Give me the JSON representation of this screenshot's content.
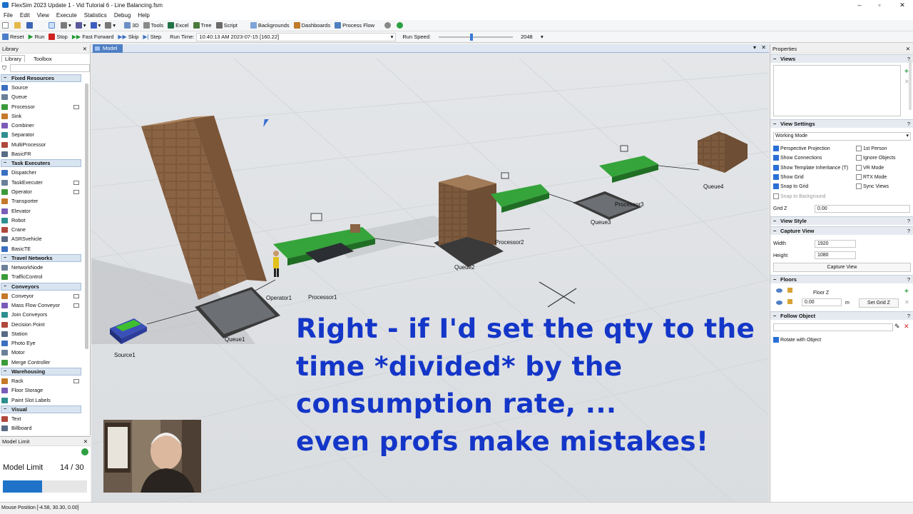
{
  "window": {
    "title": "FlexSim 2023 Update 1 - Vid Tutorial 6 - Line Balancing.fsm"
  },
  "menu": [
    "File",
    "Edit",
    "View",
    "Execute",
    "Statistics",
    "Debug",
    "Help"
  ],
  "toolbar": {
    "view3d": "3D",
    "tools": "Tools",
    "excel": "Excel",
    "tree": "Tree",
    "script": "Script",
    "backgrounds": "Backgrounds",
    "dashboards": "Dashboards",
    "process_flow": "Process Flow"
  },
  "runbar": {
    "reset": "Reset",
    "run": "Run",
    "stop": "Stop",
    "fast_forward": "Fast Forward",
    "skip": "Skip",
    "step": "Step",
    "run_time_label": "Run Time:",
    "run_time_value": "10:40:13 AM  2023-07-15  [160.22]",
    "run_speed_label": "Run Speed:",
    "run_speed_value": "2048",
    "run_speed_fraction": 0.42
  },
  "library": {
    "header": "Library",
    "tabs": [
      "Library",
      "Toolbox"
    ],
    "categories": [
      {
        "name": "Fixed Resources",
        "items": [
          "Source",
          "Queue",
          "Processor",
          "Sink",
          "Combiner",
          "Separator",
          "MultiProcessor",
          "BasicFR"
        ]
      },
      {
        "name": "Task Executers",
        "items": [
          "Dispatcher",
          "TaskExecuter",
          "Operator",
          "Transporter",
          "Elevator",
          "Robot",
          "Crane",
          "ASRSvehicle",
          "BasicTE"
        ]
      },
      {
        "name": "Travel Networks",
        "items": [
          "NetworkNode",
          "TrafficControl"
        ]
      },
      {
        "name": "Conveyors",
        "items": [
          "Conveyor",
          "Mass Flow Conveyor",
          "Join Conveyors",
          "Decision Point",
          "Station",
          "Photo Eye",
          "Motor",
          "Merge Controller"
        ]
      },
      {
        "name": "Warehousing",
        "items": [
          "Rack",
          "Floor Storage",
          "Paint Slot Labels"
        ]
      },
      {
        "name": "Visual",
        "items": [
          "Text",
          "Billboard"
        ]
      }
    ]
  },
  "model_limit": {
    "header": "Model Limit",
    "label": "Model Limit",
    "value": "14 / 30",
    "fill_fraction": 0.47
  },
  "viewport": {
    "tab": "Model",
    "objects": [
      "Source1",
      "Queue1",
      "Operator1",
      "Processor1",
      "Queue2",
      "Processor2",
      "Queue3",
      "Processor3",
      "Queue4"
    ]
  },
  "caption": [
    "Right - if I'd set the qty to the",
    "time *divided* by the",
    "consumption rate, ...",
    "even profs make mistakes!"
  ],
  "properties": {
    "header": "Properties",
    "views": {
      "title": "Views"
    },
    "view_settings": {
      "title": "View Settings",
      "mode": "Working Mode",
      "left_checks": [
        {
          "label": "Perspective Projection",
          "on": true
        },
        {
          "label": "Show Connections",
          "on": true
        },
        {
          "label": "Show Template Inheritance (T)",
          "on": true
        },
        {
          "label": "Show Grid",
          "on": true
        },
        {
          "label": "Snap to Grid",
          "on": true
        },
        {
          "label": "Snap to Background",
          "on": false
        }
      ],
      "right_checks": [
        {
          "label": "1st Person",
          "on": false
        },
        {
          "label": "Ignore Objects",
          "on": false
        },
        {
          "label": "VR Mode",
          "on": false
        },
        {
          "label": "RTX Mode",
          "on": false
        },
        {
          "label": "Sync Views",
          "on": false
        }
      ],
      "grid_z_label": "Grid Z",
      "grid_z_value": "0.00"
    },
    "view_style": {
      "title": "View Style"
    },
    "capture_view": {
      "title": "Capture View",
      "width_label": "Width",
      "width_value": "1920",
      "height_label": "Height",
      "height_value": "1080",
      "button": "Capture View"
    },
    "floors": {
      "title": "Floors",
      "floor_name": "Floor Z",
      "floor_value": "0.00",
      "unit": "m",
      "button": "Set Grid Z"
    },
    "follow_object": {
      "title": "Follow Object",
      "check": "Rotate with Object"
    }
  },
  "status": {
    "mouse_position": "Mouse Position [-4.58, 30.30, 0.00]"
  }
}
